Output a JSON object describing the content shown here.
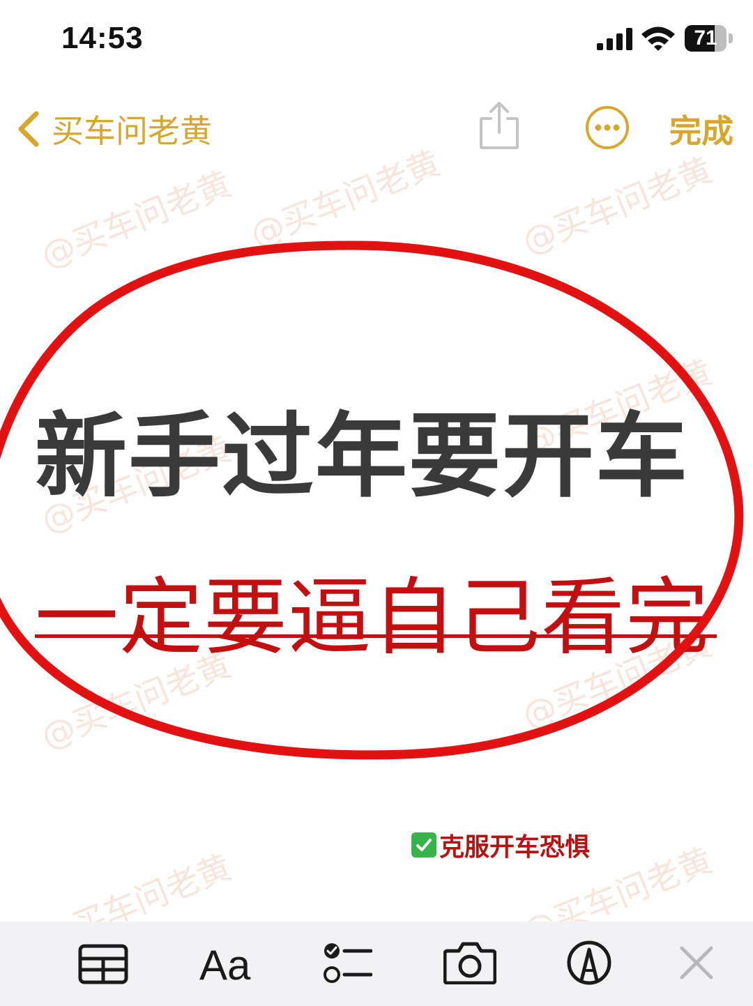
{
  "status_bar": {
    "time": "14:53",
    "battery_level": "71",
    "battery_fraction": 0.71
  },
  "nav": {
    "back_label": "买车问老黄",
    "done_label": "完成",
    "accent_color": "#d8a62a"
  },
  "watermark_text": "@买车问老黄",
  "note": {
    "headline": "新手过年要开车",
    "subheadline": "一定要逼自己看完",
    "tagline": "克服开车恐惧",
    "headline_color": "#3a3a3a",
    "subheadline_color": "#c21010",
    "annotation_color": "#e31212"
  },
  "toolbar": {
    "format_label": "Aa",
    "icons": [
      "table-icon",
      "format-icon",
      "checklist-icon",
      "camera-icon",
      "markup-icon",
      "close-icon"
    ]
  }
}
